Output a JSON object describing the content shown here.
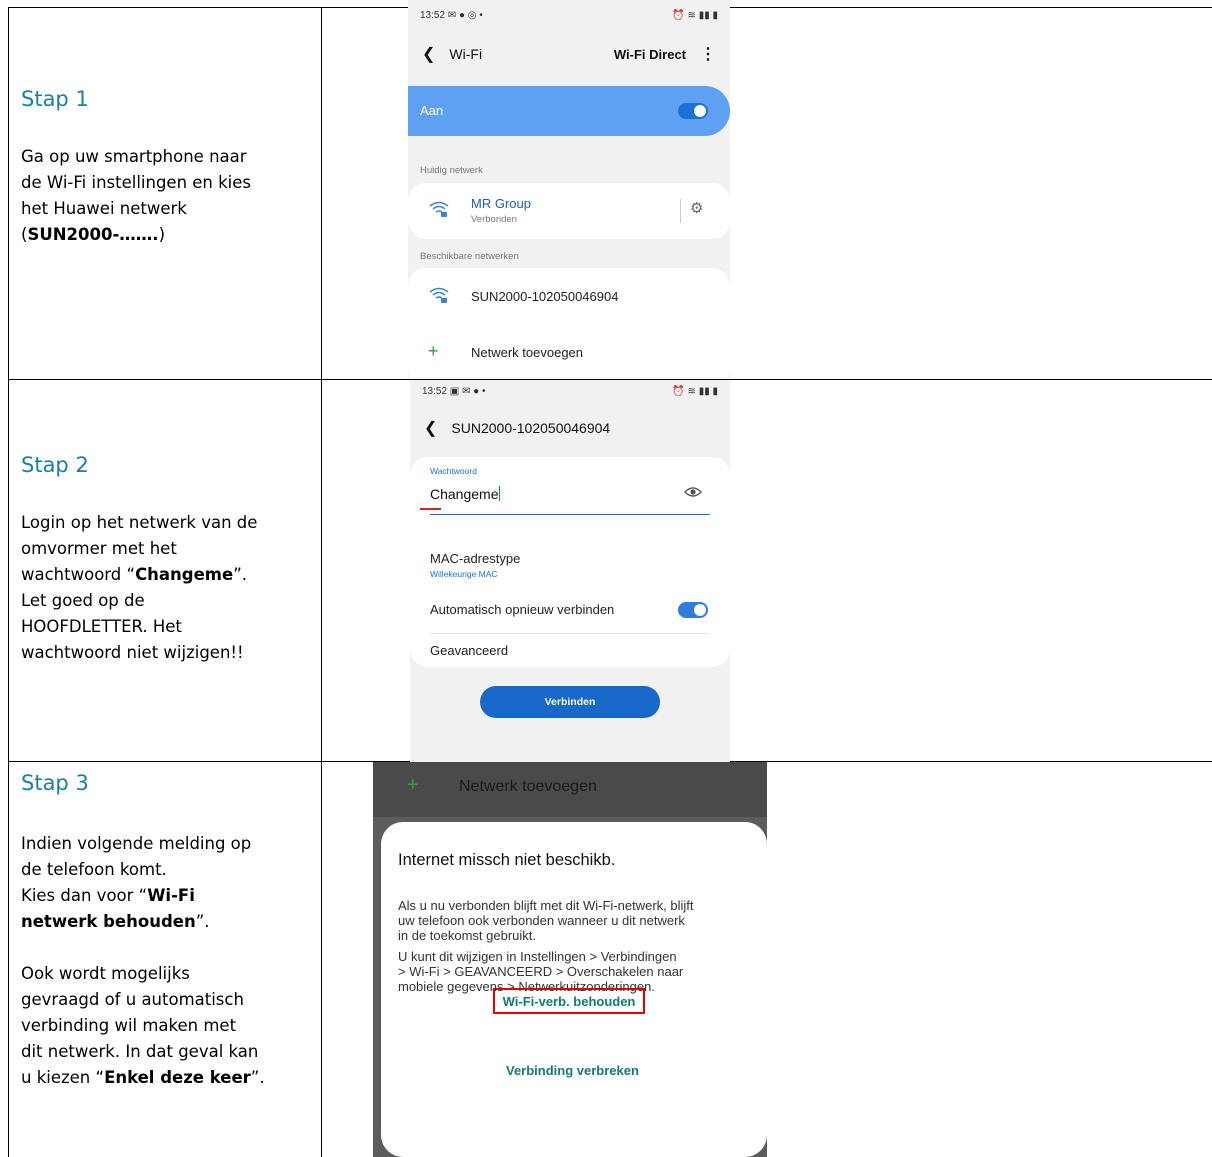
{
  "steps": [
    {
      "title": "Stap 1",
      "lines": [
        "Ga op uw smartphone naar",
        "de Wi-Fi instellingen en kies",
        "het Huawei netwerk"
      ],
      "bold": "SUN2000-…….",
      "open": "(",
      "close": ")"
    },
    {
      "title": "Stap 2",
      "l1": "Login op het netwerk van de",
      "l2": "omvormer met het",
      "l3_pre": "wachtwoord “",
      "l3_bold": "Changeme",
      "l3_post": "”.",
      "l4": "Let goed op de",
      "l5": "HOOFDLETTER. Het",
      "l6": "wachtwoord niet wijzigen!!"
    },
    {
      "title": "Stap 3",
      "l1": "Indien volgende melding op",
      "l2": "de telefoon komt.",
      "l3_pre": "Kies dan voor “",
      "l3_bold": "Wi-Fi",
      "l4_bold": "netwerk behouden",
      "l4_post": "”.",
      "l5": "Ook wordt mogelijks",
      "l6": "gevraagd of u automatisch",
      "l7": "verbinding wil maken met",
      "l8": "dit netwerk. In dat geval kan",
      "l9_pre": "u kiezen “",
      "l9_bold": "Enkel deze keer",
      "l9_post": "”."
    }
  ],
  "screen1": {
    "time": "13:52 ✉ ● ◎ •",
    "status_right": "⏰ ≋ ▮▮ ▮",
    "back_label": "Wi-Fi",
    "wifi_direct": "Wi-Fi Direct",
    "kebab": "⋮",
    "aan": "Aan",
    "current_label": "Huidig netwerk",
    "current_name": "MR Group",
    "current_status": "Verbonden",
    "available_label": "Beschikbare netwerken",
    "available_name": "SUN2000-102050046904",
    "add_network": "Netwerk toevoegen"
  },
  "screen2": {
    "time": "13:52 ▣ ✉ ● •",
    "status_right": "⏰ ≋ ▮▮ ▮",
    "network_title": "SUN2000-102050046904",
    "password_label": "Wachtwoord",
    "password_value": "Changeme",
    "mac_label": "MAC-adrestype",
    "mac_value": "Willekeurige MAC",
    "auto_reconnect": "Automatisch opnieuw verbinden",
    "advanced": "Geavanceerd",
    "connect_button": "Verbinden"
  },
  "screen3": {
    "top_item": "Netwerk toevoegen",
    "dialog_title": "Internet missch niet beschikb.",
    "para1": [
      "Als u nu verbonden blijft met dit Wi-Fi-netwerk, blijft",
      "uw telefoon ook verbonden wanneer u dit netwerk",
      "in de toekomst gebruikt."
    ],
    "para2": [
      "U kunt dit wijzigen in Instellingen > Verbindingen",
      "> Wi-Fi > GEAVANCEERD > Overschakelen naar",
      "mobiele gegevens > Netwerkuitzonderingen."
    ],
    "keep_button": "Wi-Fi-verb. behouden",
    "disconnect_button": "Verbinding verbreken"
  }
}
